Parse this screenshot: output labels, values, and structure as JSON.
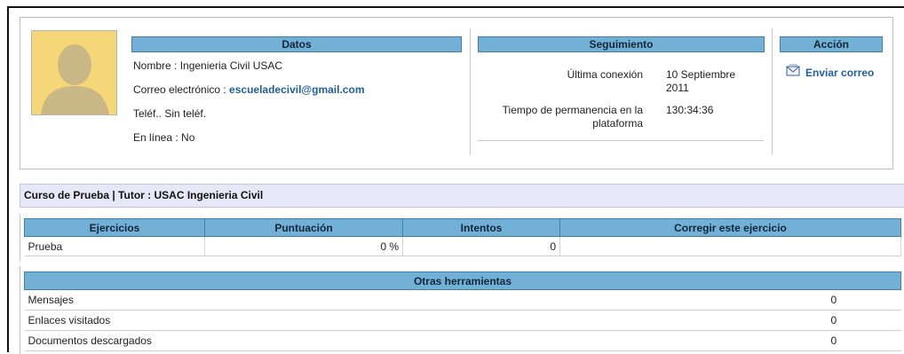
{
  "datos": {
    "header": "Datos",
    "nombre_label": "Nombre : ",
    "nombre": "Ingenieria Civil USAC",
    "correo_label": "Correo electrónico : ",
    "correo": "escueladecivil@gmail.com",
    "telefono": "Teléf.. Sin teléf.",
    "en_linea": "En línea : No"
  },
  "seguimiento": {
    "header": "Seguimiento",
    "ultima_conexion_label": "Última conexión",
    "ultima_conexion_line1": "10 Septiembre",
    "ultima_conexion_line2": "2011",
    "permanencia_label_line1": "Tiempo de permanencia en la",
    "permanencia_label_line2": "plataforma",
    "permanencia_value": "130:34:36"
  },
  "accion": {
    "header": "Acción",
    "enviar_correo": "Enviar correo"
  },
  "course": {
    "title": "Curso de Prueba  |  Tutor : USAC Ingenieria Civil"
  },
  "ejercicios": {
    "headers": [
      "Ejercicios",
      "Puntuación",
      "Intentos",
      "Corregir este ejercicio"
    ],
    "rows": [
      {
        "nombre": "Prueba",
        "puntuacion": "0 %",
        "intentos": "0",
        "corregir": ""
      }
    ]
  },
  "otras": {
    "header": "Otras herramientas",
    "rows": [
      {
        "label": "Mensajes",
        "value": "0"
      },
      {
        "label": "Enlaces visitados",
        "value": "0"
      },
      {
        "label": "Documentos descargados",
        "value": "0"
      }
    ]
  },
  "colors": {
    "header_bg": "#73b0d6",
    "link": "#1f5f9e",
    "course_bar_bg": "#e6e8f8",
    "avatar_bg": "#f6d97a"
  }
}
